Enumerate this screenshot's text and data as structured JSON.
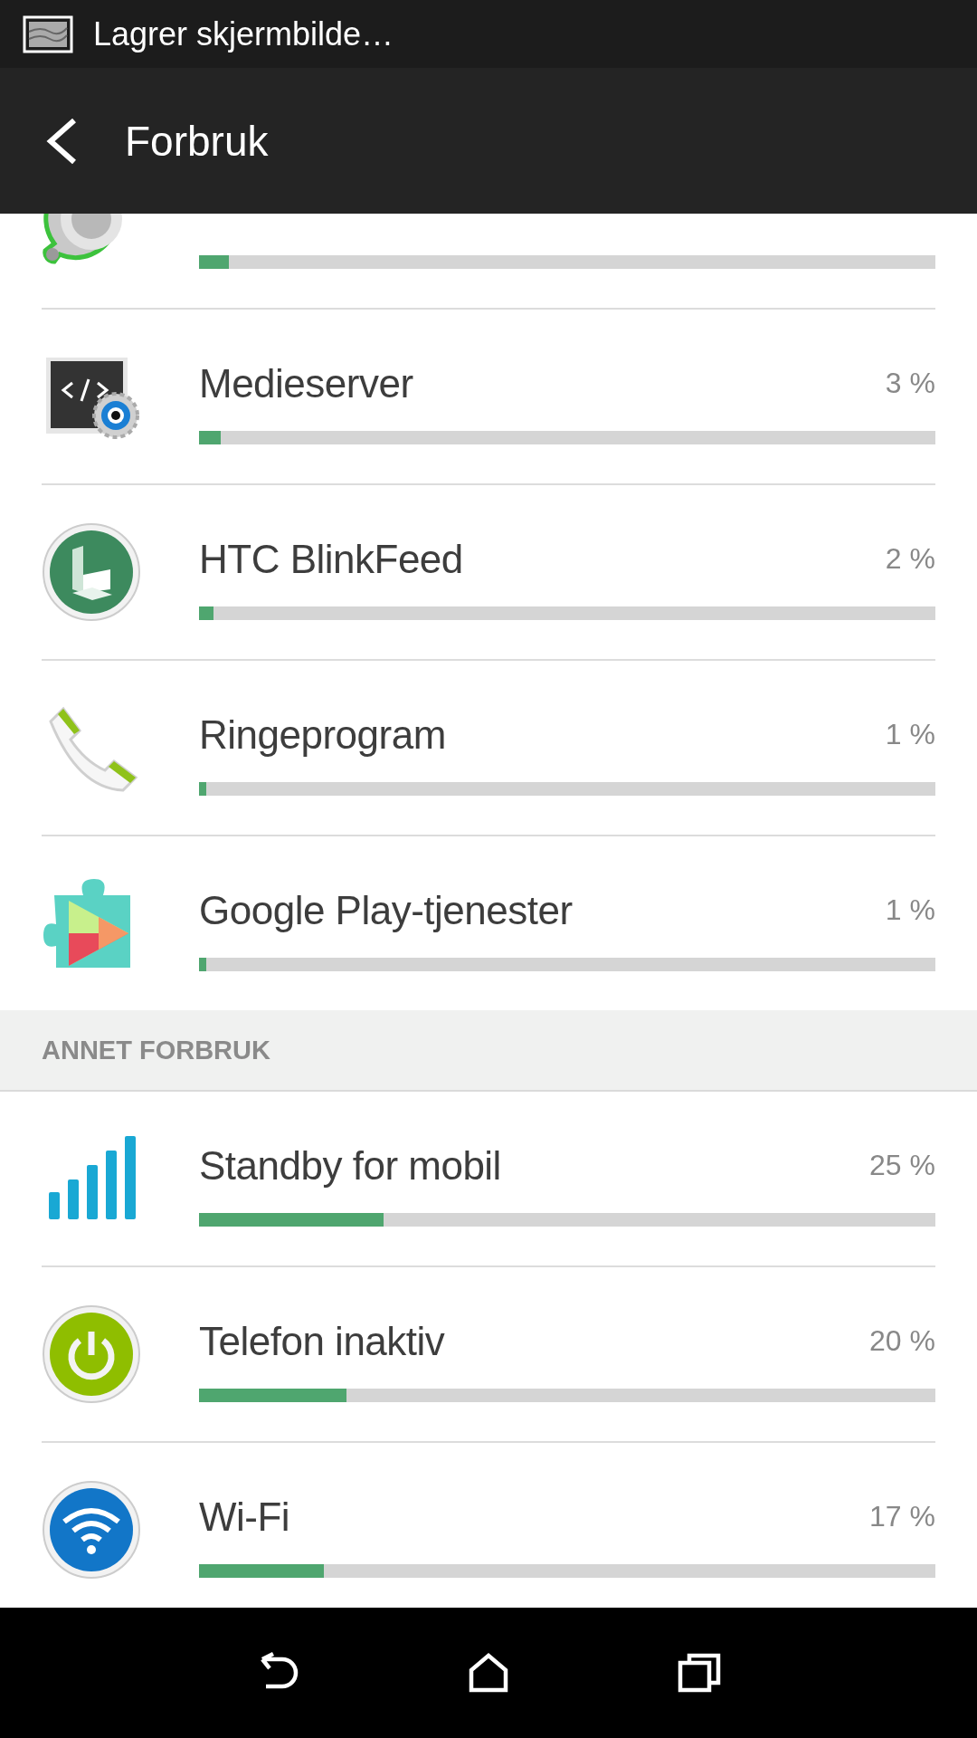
{
  "status_bar": {
    "notification": "Lagrer skjermbilde…"
  },
  "header": {
    "title": "Forbruk"
  },
  "app_rows": [
    {
      "level": 0.04
    },
    {
      "title": "Medieserver",
      "percent": "3 %",
      "level": 0.03
    },
    {
      "title": "HTC BlinkFeed",
      "percent": "2 %",
      "level": 0.02
    },
    {
      "title": "Ringeprogram",
      "percent": "1 %",
      "level": 0.01
    },
    {
      "title": "Google Play-tjenester",
      "percent": "1 %",
      "level": 0.01
    }
  ],
  "other_section": {
    "heading": "ANNET FORBRUK",
    "rows": [
      {
        "title": "Standby for mobil",
        "percent": "25 %",
        "level": 0.25
      },
      {
        "title": "Telefon inaktiv",
        "percent": "20 %",
        "level": 0.2
      },
      {
        "title": "Wi-Fi",
        "percent": "17 %",
        "level": 0.17
      }
    ]
  }
}
